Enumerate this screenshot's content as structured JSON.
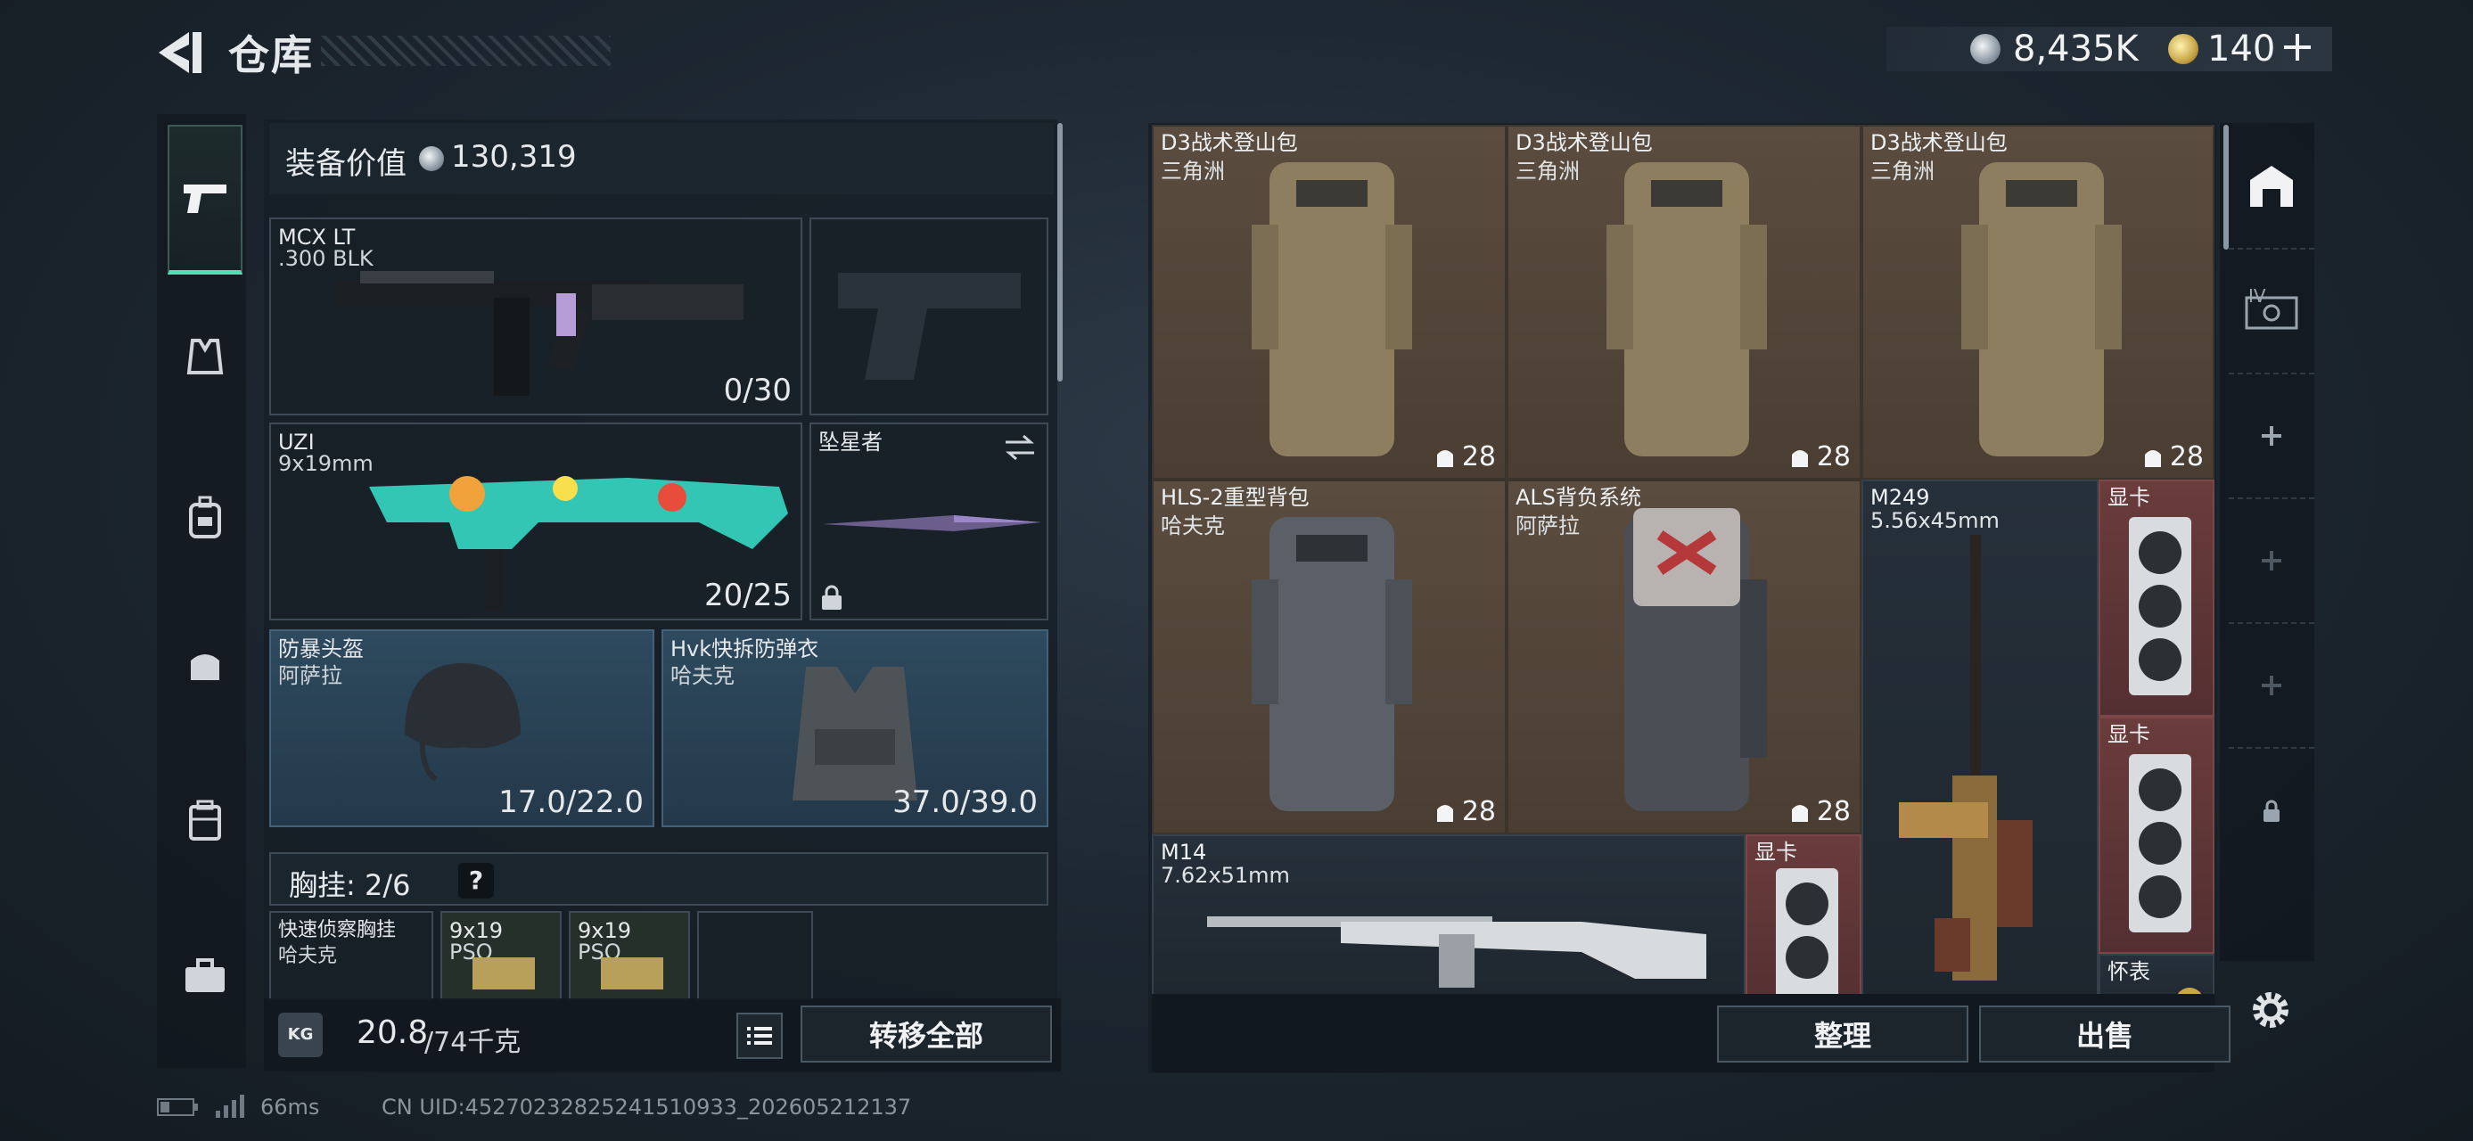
{
  "header": {
    "title": "仓库"
  },
  "currency": {
    "coins": "8,435K",
    "tickets": "140"
  },
  "equipment": {
    "value_label": "装备价值",
    "value": "130,319",
    "primary": {
      "name": "MCX LT",
      "caliber": ".300 BLK",
      "ammo": "0/30"
    },
    "secondary": {
      "name": "UZI",
      "caliber": "9x19mm",
      "ammo": "20/25"
    },
    "melee": {
      "name": "坠星者"
    },
    "helmet": {
      "name": "防暴头盔",
      "origin": "阿萨拉",
      "durability": "17.0/22.0"
    },
    "armor": {
      "name": "Hvk快拆防弹衣",
      "origin": "哈夫克",
      "durability": "37.0/39.0"
    },
    "chest_rig": {
      "label": "胸挂: 2/6",
      "help": "?"
    },
    "rig_items": [
      {
        "name": "快速侦察胸挂",
        "origin": "哈夫克"
      },
      {
        "name": "9x19",
        "sub": "PSO"
      },
      {
        "name": "9x19",
        "sub": "PSO"
      }
    ],
    "weight": "20.8",
    "weight_max": "/74千克",
    "weight_icon": "KG",
    "transfer_all": "转移全部"
  },
  "storage": {
    "items": [
      {
        "name": "D3战术登山包",
        "origin": "三角洲",
        "count": "28"
      },
      {
        "name": "D3战术登山包",
        "origin": "三角洲",
        "count": "28"
      },
      {
        "name": "D3战术登山包",
        "origin": "三角洲",
        "count": "28"
      },
      {
        "name": "HLS-2重型背包",
        "origin": "哈夫克",
        "count": "28"
      },
      {
        "name": "ALS背负系统",
        "origin": "阿萨拉",
        "count": "28"
      },
      {
        "name": "M249",
        "origin": "5.56x45mm"
      },
      {
        "name": "M14",
        "origin": "7.62x51mm"
      }
    ],
    "gpu_label": "显卡",
    "watch_label": "怀表",
    "sort_button": "整理",
    "sell_button": "出售"
  },
  "right_tabs": {
    "tier_label": "IV"
  },
  "status": {
    "ping": "66ms",
    "uid": "CN UID:45270232825241510933_202605212137"
  },
  "colors": {
    "accent": "#4fe0b4",
    "tan_cell": "#5a4c3e",
    "red_cell": "#6a3c3c"
  }
}
